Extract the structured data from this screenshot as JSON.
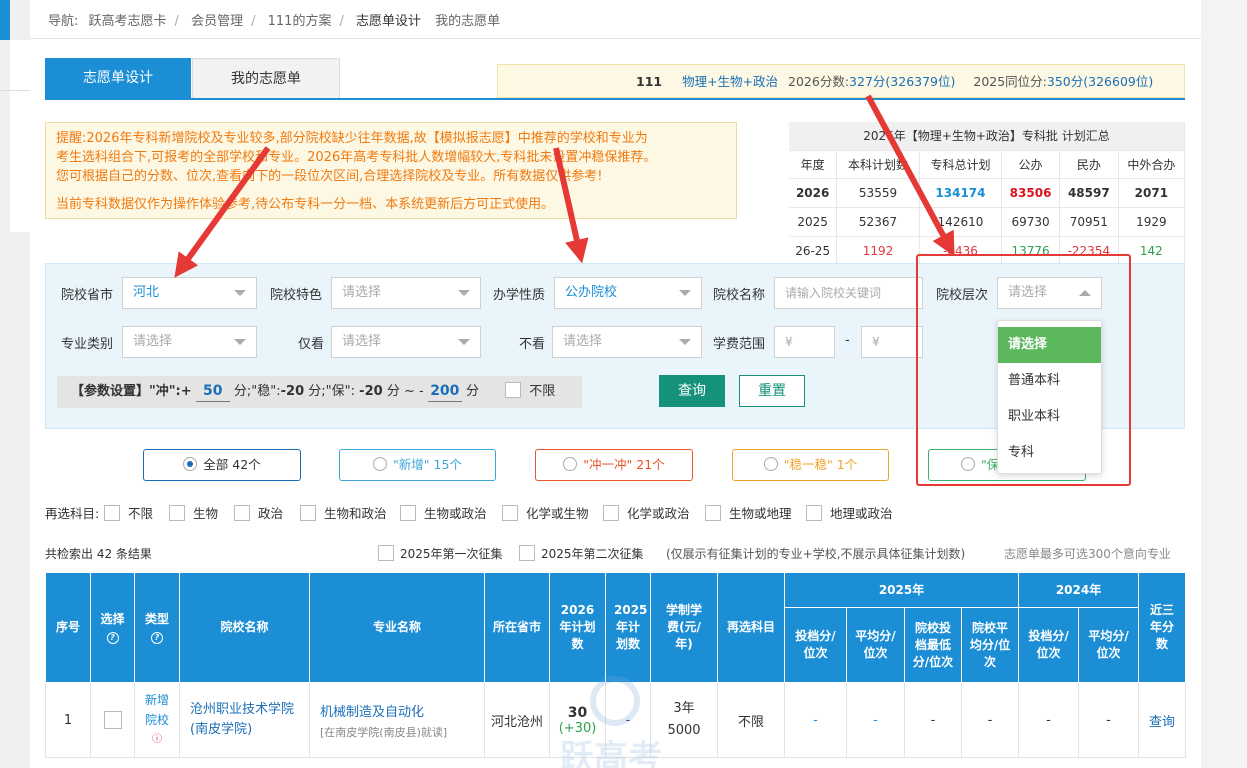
{
  "breadcrumb": {
    "prefix": "导航:",
    "items": [
      "跃高考志愿卡",
      "会员管理",
      "111的方案",
      "志愿单设计"
    ],
    "extra": "我的志愿单"
  },
  "tabs": [
    "志愿单设计",
    "我的志愿单"
  ],
  "summary": {
    "name": "111",
    "subjects": "物理+生物+政治",
    "score_label": "2026分数:",
    "score": "327分(326379位)",
    "prev_label": "2025同位分:",
    "prev": "350分(326609位)"
  },
  "notice": {
    "lines": [
      "提醒:2026年专科新增院校及专业较多,部分院校缺少往年数据,故【模拟报志愿】中推荐的学校和专业为",
      "考生选科组合下,可报考的全部学校和专业。2026年高考专科批人数增幅较大,专科批未设置冲稳保推荐。",
      "您可根据自己的分数、位次,查看向下的一段位次区间,合理选择院校及专业。所有数据仅供参考!"
    ],
    "line4": "当前专科数据仅作为操作体验参考,待公布专科一分一档、本系统更新后方可正式使用。"
  },
  "plan_table": {
    "title": "2026年【物理+生物+政治】专科批 计划汇总",
    "headers": [
      "年度",
      "本科计划数",
      "专科总计划",
      "公办",
      "民办",
      "中外合办"
    ],
    "rows": [
      [
        "2026",
        "53559",
        "134174",
        "83506",
        "48597",
        "2071"
      ],
      [
        "2025",
        "52367",
        "142610",
        "69730",
        "70951",
        "1929"
      ],
      [
        "26-25",
        "1192",
        "-8436",
        "13776",
        "-22354",
        "142"
      ]
    ]
  },
  "filters": {
    "province_label": "院校省市",
    "province_value": "河北",
    "feature_label": "院校特色",
    "feature_ph": "请选择",
    "nature_label": "办学性质",
    "nature_value": "公办院校",
    "name_label": "院校名称",
    "name_ph": "请输入院校关键词",
    "level_label": "院校层次",
    "level_ph": "请选择",
    "major_label": "专业类别",
    "major_ph": "请选择",
    "only_label": "仅看",
    "only_ph": "请选择",
    "exclude_label": "不看",
    "exclude_ph": "请选择",
    "fee_label": "学费范围",
    "fee_min": "¥",
    "fee_dash": "-",
    "fee_max": "¥"
  },
  "params": {
    "prefix": "【参数设置】\"冲\":+",
    "chong": "50",
    "mid1": "分;\"稳\":",
    "wen": "-20",
    "mid2": "分;\"保\":",
    "bao1": "-20",
    "mid3": "分 ~ -",
    "bao2": "200",
    "suffix": "分",
    "unlimit": "不限"
  },
  "buttons": {
    "query": "查询",
    "reset": "重置"
  },
  "level_options": [
    "请选择",
    "普通本科",
    "职业本科",
    "专科"
  ],
  "pills": [
    {
      "label": "全部 42个",
      "color": "#1b6fb8"
    },
    {
      "label": "\"新增\" 15个",
      "color": "#3aa7d8"
    },
    {
      "label": "\"冲一冲\" 21个",
      "color": "#e8562a"
    },
    {
      "label": "\"稳一稳\" 1个",
      "color": "#f0a22a"
    },
    {
      "label": "\"保",
      "color": "#3ab06a"
    }
  ],
  "subjects": {
    "label": "再选科目:",
    "options": [
      "不限",
      "生物",
      "政治",
      "生物和政治",
      "生物或政治",
      "化学或生物",
      "化学或政治",
      "生物或地理",
      "地理或政治"
    ]
  },
  "result": {
    "count": "共检索出 42 条结果",
    "opt1": "2025年第一次征集",
    "opt2": "2025年第二次征集",
    "note": "(仅展示有征集计划的专业+学校,不展示具体征集计划数)",
    "limit": "志愿单最多可选300个意向专业"
  },
  "grid_headers": {
    "seq": "序号",
    "select": "选择",
    "type": "类型",
    "school": "院校名称",
    "major": "专业名称",
    "location": "所在省市",
    "plan2026": "2026年计划数",
    "plan2025": "2025年计划数",
    "fee": "学制学费(元/年)",
    "subject": "再选科目",
    "y2025": "2025年",
    "y2024": "2024年",
    "near3": "近三年分数",
    "sub": [
      "投档分/位次",
      "平均分/位次",
      "院校投档最低分/位次",
      "院校平均分/位次",
      "投档分/位次",
      "平均分/位次"
    ]
  },
  "row1": {
    "seq": "1",
    "type1": "新增",
    "type2": "院校",
    "school": "沧州职业技术学院(南皮学院)",
    "major": "机械制造及自动化",
    "major_note": "[在南皮学院(南皮县)就读]",
    "location": "河北沧州",
    "plan": "30",
    "plan_delta": "(+30)",
    "plan25": "-",
    "fee1": "3年",
    "fee2": "5000",
    "subject": "不限",
    "c1": "-",
    "c2": "-",
    "c3": "-",
    "c4": "-",
    "c5": "-",
    "c6": "-",
    "query": "查询"
  },
  "watermark": "跃高考"
}
